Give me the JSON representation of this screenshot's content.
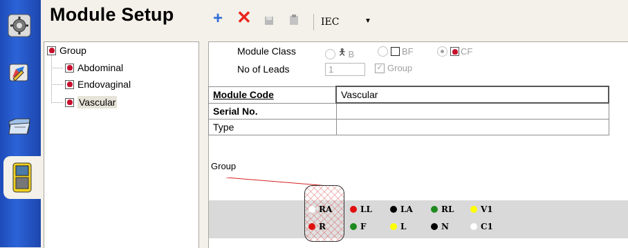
{
  "sidebar": {
    "items": [
      {
        "icon": "gear-icon"
      },
      {
        "icon": "edit-icon"
      },
      {
        "icon": "folder-icon"
      },
      {
        "icon": "module-device-icon"
      }
    ]
  },
  "header": {
    "title": "Module Setup",
    "toolbar": {
      "add_icon": "plus-icon",
      "delete_icon": "close-icon",
      "standard": "IEC"
    }
  },
  "tree": {
    "root": "Group",
    "children": [
      "Abdominal",
      "Endovaginal",
      "Vascular"
    ],
    "selected": "Vascular"
  },
  "module_class": {
    "label": "Module Class",
    "options": [
      {
        "label": "B",
        "selected": false
      },
      {
        "label": "BF",
        "selected": false
      },
      {
        "label": "CF",
        "selected": true
      }
    ]
  },
  "no_of_leads": {
    "label": "No of Leads",
    "value": "1",
    "group_label": "Group",
    "group_checked": true
  },
  "fields": [
    {
      "label": "Module Code",
      "value": "Vascular"
    },
    {
      "label": "Serial No.",
      "value": ""
    },
    {
      "label": "Type",
      "value": ""
    }
  ],
  "diagram": {
    "group_label": "Group",
    "leads": [
      {
        "label": "RA",
        "color": "#ffffff"
      },
      {
        "label": "LL",
        "color": "#e01010"
      },
      {
        "label": "LA",
        "color": "#000000"
      },
      {
        "label": "RL",
        "color": "#1f8a1f"
      },
      {
        "label": "V1",
        "color": "#ffff00"
      },
      {
        "label": "R",
        "color": "#e01010"
      },
      {
        "label": "F",
        "color": "#1f8a1f"
      },
      {
        "label": "L",
        "color": "#ffff00"
      },
      {
        "label": "N",
        "color": "#000000"
      },
      {
        "label": "C1",
        "color": "#ffffff"
      }
    ]
  }
}
